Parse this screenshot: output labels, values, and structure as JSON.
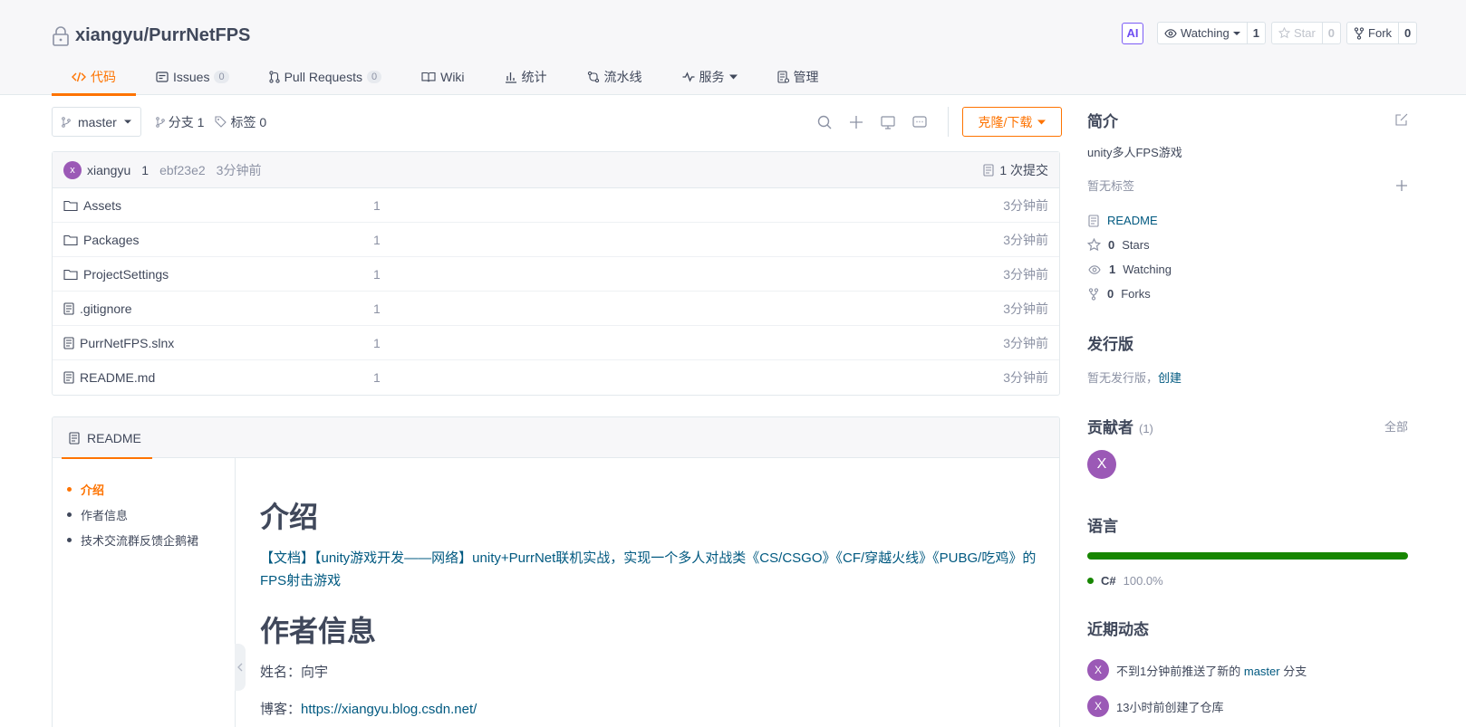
{
  "repo": {
    "owner": "xiangyu",
    "name": "PurrNetFPS",
    "full_name": "xiangyu/PurrNetFPS"
  },
  "header_actions": {
    "ai_label": "AI",
    "watch": {
      "label": "Watching",
      "count": "1"
    },
    "star": {
      "label": "Star",
      "count": "0"
    },
    "fork": {
      "label": "Fork",
      "count": "0"
    }
  },
  "tabs": [
    {
      "label": "代码",
      "active": true
    },
    {
      "label": "Issues",
      "badge": "0"
    },
    {
      "label": "Pull Requests",
      "badge": "0"
    },
    {
      "label": "Wiki"
    },
    {
      "label": "统计"
    },
    {
      "label": "流水线"
    },
    {
      "label": "服务"
    },
    {
      "label": "管理"
    }
  ],
  "toolbar": {
    "branch": "master",
    "branches_label": "分支 1",
    "tags_label": "标签 0",
    "clone_label": "克隆/下载"
  },
  "latest_commit": {
    "avatar": "x",
    "author": "xiangyu",
    "message": "1",
    "sha": "ebf23e2",
    "time": "3分钟前",
    "commits_label": "1 次提交"
  },
  "files": [
    {
      "type": "folder",
      "name": "Assets",
      "message": "1",
      "time": "3分钟前"
    },
    {
      "type": "folder",
      "name": "Packages",
      "message": "1",
      "time": "3分钟前"
    },
    {
      "type": "folder",
      "name": "ProjectSettings",
      "message": "1",
      "time": "3分钟前"
    },
    {
      "type": "file",
      "name": ".gitignore",
      "message": "1",
      "time": "3分钟前"
    },
    {
      "type": "file",
      "name": "PurrNetFPS.slnx",
      "message": "1",
      "time": "3分钟前"
    },
    {
      "type": "file",
      "name": "README.md",
      "message": "1",
      "time": "3分钟前"
    }
  ],
  "readme": {
    "tab_label": "README",
    "toc": [
      "介绍",
      "作者信息",
      "技术交流群反馈企鹅裙"
    ],
    "h1_intro": "介绍",
    "intro_text": "【文档】【unity游戏开发——网络】unity+PurrNet联机实战，实现一个多人对战类《CS/CSGO》《CF/穿越火线》《PUBG/吃鸡》的FPS射击游戏",
    "h1_author": "作者信息",
    "name_line": "姓名：向宇",
    "blog_prefix": "博客：",
    "blog_url": "https://xiangyu.blog.csdn.net/"
  },
  "sidebar": {
    "intro_title": "简介",
    "description": "unity多人FPS游戏",
    "no_tags": "暂无标签",
    "readme_link": "README",
    "stars": {
      "count": "0",
      "label": "Stars"
    },
    "watching": {
      "count": "1",
      "label": "Watching"
    },
    "forks": {
      "count": "0",
      "label": "Forks"
    },
    "releases_title": "发行版",
    "no_releases": "暂无发行版，",
    "create_link": "创建",
    "contributors_title": "贡献者",
    "contributors_count": "(1)",
    "contributors_all": "全部",
    "contributor_avatar": "X",
    "language_title": "语言",
    "language": {
      "name": "C#",
      "percent": "100.0%",
      "color": "#178600"
    },
    "activity_title": "近期动态",
    "activities": [
      {
        "avatar": "X",
        "prefix": "不到1分钟前推送了新的",
        "link": "master",
        "suffix": "分支"
      },
      {
        "avatar": "X",
        "text": "13小时前创建了仓库"
      }
    ]
  },
  "colors": {
    "accent": "#fe7300",
    "link": "#005980",
    "avatar": "#9b59b6"
  }
}
